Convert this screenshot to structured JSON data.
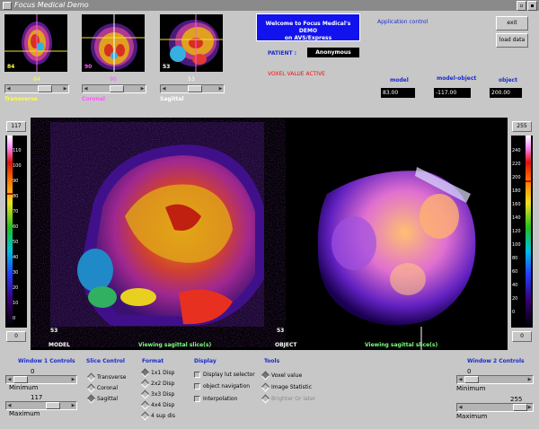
{
  "window": {
    "title": "Focus Medical Demo",
    "btn_min": "▫",
    "btn_max": "▪"
  },
  "thumbnails": [
    {
      "num": "84",
      "label": "Transverse",
      "slider_value": "84",
      "num_color": "#ffff40",
      "label_color": "#ffff40"
    },
    {
      "num": "90",
      "label": "Coronal",
      "slider_value": "90",
      "num_color": "#ff55ff",
      "label_color": "#ff55ff"
    },
    {
      "num": "53",
      "label": "Sagittal",
      "slider_value": "53",
      "num_color": "#ffffff",
      "label_color": "#ffffff"
    }
  ],
  "welcome": {
    "line1": "Welcome to Focus Medical's DEMO",
    "line2": "on AVS/Express"
  },
  "patient": {
    "label": "PATIENT :",
    "value": "Anonymous"
  },
  "voxel_status": "VOXEL VALUE ACTIVE",
  "app_control": {
    "label": "Application control",
    "exit": "exit",
    "load": "load data"
  },
  "coords": {
    "model_label": "model",
    "model_value": "83.00",
    "mo_label": "model-object",
    "mo_value": "-117.00",
    "object_label": "object",
    "object_value": "200.00"
  },
  "left_lut": {
    "max": "117",
    "min": "0",
    "ticks": [
      "110",
      "100",
      "90",
      "80",
      "70",
      "60",
      "50",
      "40",
      "30",
      "20",
      "10",
      "0"
    ]
  },
  "right_lut": {
    "max": "255",
    "min": "0",
    "ticks": [
      "240",
      "220",
      "200",
      "180",
      "160",
      "140",
      "120",
      "100",
      "80",
      "60",
      "40",
      "20",
      "0"
    ]
  },
  "view": {
    "left_slice": "53",
    "right_slice": "53",
    "model_label": "MODEL",
    "object_label": "OBJECT",
    "viewing_left": "Viewing sagittal slice(s)",
    "viewing_right": "Viewing sagittal slice(s)"
  },
  "w1": {
    "title": "Window 1 Controls",
    "min_val": "0",
    "min_label": "Minimum",
    "max_val": "117",
    "max_label": "Maximum"
  },
  "slice_control": {
    "title": "Slice Control",
    "options": [
      "Transverse",
      "Coronal",
      "Sagittal"
    ],
    "selected": 2
  },
  "format": {
    "title": "Format",
    "options": [
      "1x1 Disp",
      "2x2 Disp",
      "3x3 Disp",
      "4x4 Disp",
      "4 sup dis"
    ],
    "selected": 0
  },
  "display": {
    "title": "Display",
    "options": [
      "Display lut selector",
      "object navigation",
      "Interpolation"
    ]
  },
  "tools": {
    "title": "Tools",
    "options": [
      "Voxel value",
      "Image Statistic",
      "Brighter Or later"
    ],
    "selected": 0
  },
  "w2": {
    "title": "Window 2 Controls",
    "min_val": "0",
    "min_label": "Minimum",
    "max_val": "255",
    "max_label": "Maximum"
  },
  "colors": {
    "accent_blue": "#1a2bd0",
    "welcome_bg": "#1212ee",
    "status_red": "#e11111",
    "viewing_green": "#7dff7d"
  }
}
